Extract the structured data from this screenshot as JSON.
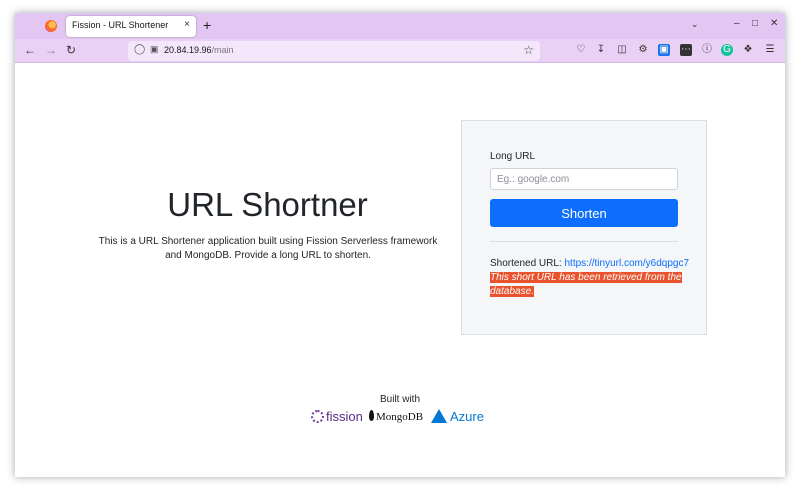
{
  "browser": {
    "tab_title": "Fission - URL Shortener",
    "tab_close": "×",
    "new_tab": "+",
    "url_host": "20.84.19.96",
    "url_path": "/main",
    "window_controls": [
      "–",
      "□",
      "✕"
    ]
  },
  "page": {
    "title": "URL Shortner",
    "description": "This is a URL Shortener application built using Fission Serverless framework and MongoDB. Provide a long URL to shorten.",
    "form": {
      "label": "Long URL",
      "placeholder": "Eg.: google.com",
      "value": "",
      "button": "Shorten"
    },
    "result": {
      "label": "Shortened URL:",
      "link": "https://tinyurl.com/y6dqpgc7",
      "notice": "This short URL has been retrieved from the database."
    },
    "footer": {
      "built_with": "Built with",
      "logos": [
        "fission",
        "MongoDB",
        "Azure"
      ]
    }
  },
  "colors": {
    "browser_chrome": "#e3c6f2",
    "primary_button": "#0d6efd",
    "notice_background": "#e8532d"
  }
}
